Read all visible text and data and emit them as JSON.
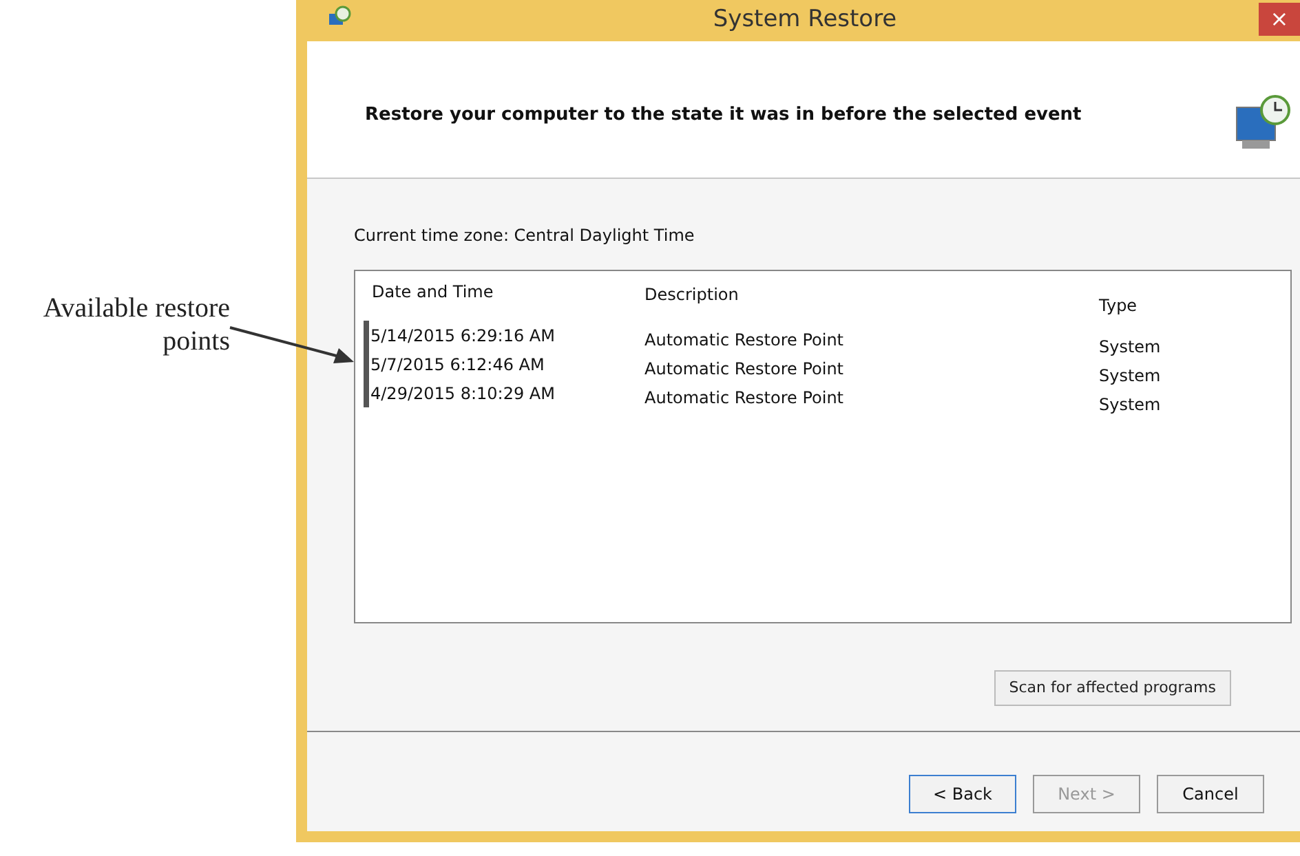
{
  "callout": {
    "text": "Available restore points"
  },
  "window": {
    "title": "System Restore",
    "close": "×"
  },
  "header": {
    "instruction": "Restore your computer to the state it was in before the selected event"
  },
  "time_zone": "Current time zone: Central Daylight Time",
  "table": {
    "columns": [
      "Date and Time",
      "Description",
      "Type"
    ],
    "rows": [
      {
        "date": "5/14/2015 6:29:16 AM",
        "description": "Automatic Restore Point",
        "type": "System"
      },
      {
        "date": "5/7/2015 6:12:46 AM",
        "description": "Automatic Restore Point",
        "type": "System"
      },
      {
        "date": "4/29/2015 8:10:29 AM",
        "description": "Automatic Restore Point",
        "type": "System"
      }
    ]
  },
  "scan_button": "Scan for affected programs",
  "buttons": [
    {
      "label": "< Back",
      "disabled": false,
      "default": true
    },
    {
      "label": "Next >",
      "disabled": true,
      "default": false
    },
    {
      "label": "Cancel",
      "disabled": false,
      "default": false
    }
  ]
}
